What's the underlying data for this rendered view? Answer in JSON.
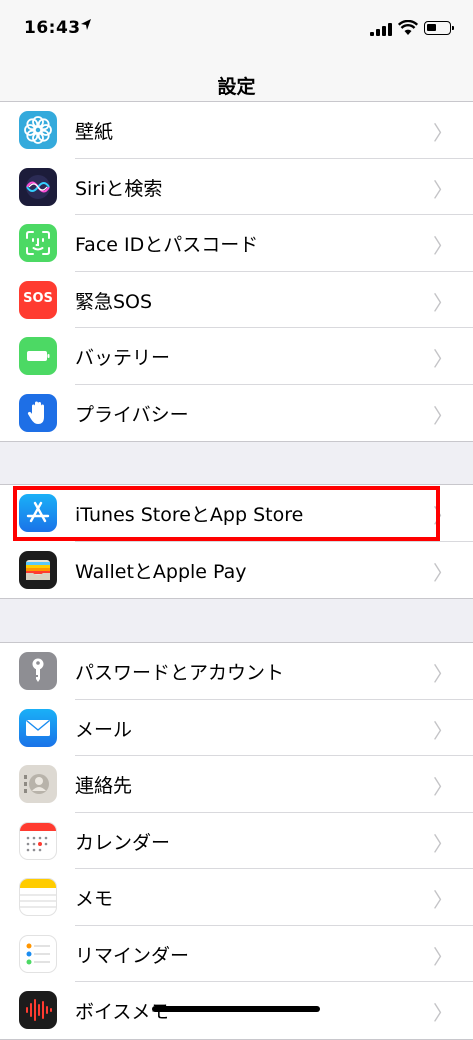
{
  "status": {
    "time": "16:43",
    "location_icon": "location-arrow-icon"
  },
  "nav": {
    "title": "設定"
  },
  "group1": [
    {
      "label": "壁紙",
      "icon": "wallpaper-icon",
      "color": "#34aadc"
    },
    {
      "label": "Siriと検索",
      "icon": "siri-icon",
      "color": "#1c1c3a"
    },
    {
      "label": "Face IDとパスコード",
      "icon": "face-id-icon",
      "color": "#4cd964"
    },
    {
      "label": "緊急SOS",
      "icon": "sos-icon",
      "color": "#ff3b30",
      "icon_text": "SOS"
    },
    {
      "label": "バッテリー",
      "icon": "battery-icon",
      "color": "#4cd964"
    },
    {
      "label": "プライバシー",
      "icon": "privacy-hand-icon",
      "color": "#1e6fe6"
    }
  ],
  "group2": [
    {
      "label": "iTunes StoreとApp Store",
      "icon": "app-store-icon",
      "color": "#1a8cf0"
    },
    {
      "label": "WalletとApple Pay",
      "icon": "wallet-icon",
      "color": "#1c1c1c"
    }
  ],
  "group3": [
    {
      "label": "パスワードとアカウント",
      "icon": "key-icon",
      "color": "#8e8e93"
    },
    {
      "label": "メール",
      "icon": "mail-icon",
      "color": "#1a8cf0"
    },
    {
      "label": "連絡先",
      "icon": "contacts-icon",
      "color": "#c7c3bc"
    },
    {
      "label": "カレンダー",
      "icon": "calendar-icon",
      "color": "#ffffff"
    },
    {
      "label": "メモ",
      "icon": "notes-icon",
      "color": "#ffffff"
    },
    {
      "label": "リマインダー",
      "icon": "reminders-icon",
      "color": "#ffffff"
    },
    {
      "label": "ボイスメモ",
      "icon": "voice-memo-icon",
      "color": "#1c1c1c"
    }
  ],
  "chevron": "〉",
  "highlight_color": "#ff0000"
}
